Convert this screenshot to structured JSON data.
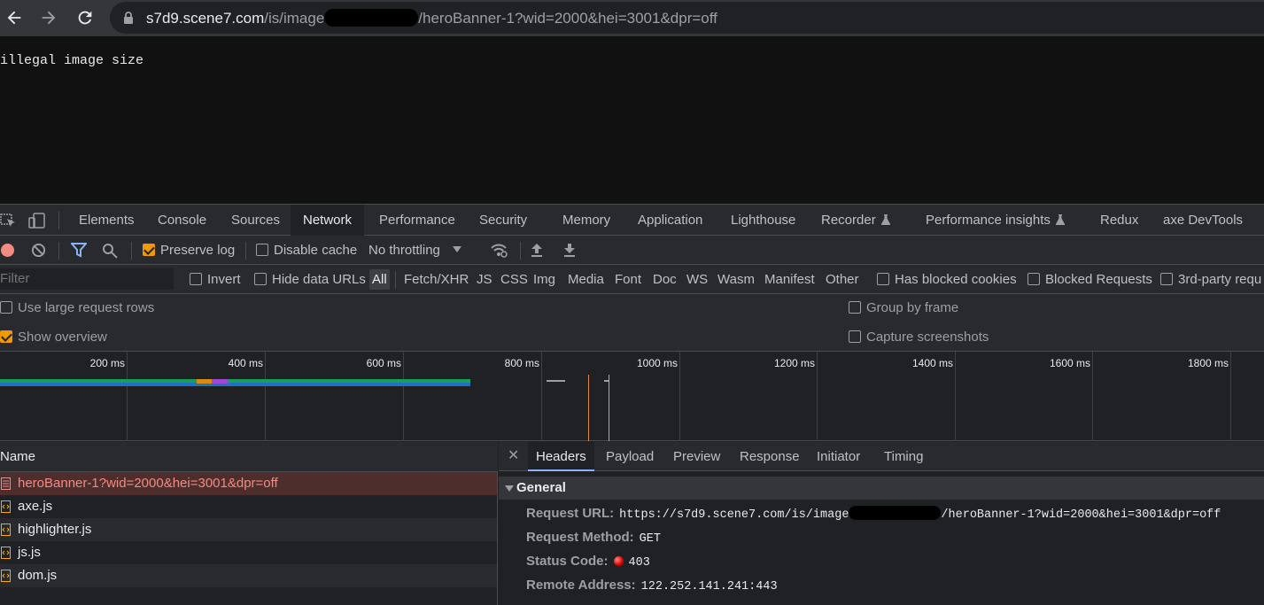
{
  "browser": {
    "url_host": "s7d9.scene7.com",
    "url_path_prefix": "/is/image",
    "url_path_suffix": "/heroBanner-1?wid=2000&hei=3001&dpr=off"
  },
  "page": {
    "body_text": "illegal image size"
  },
  "devtools": {
    "tabs": [
      "Elements",
      "Console",
      "Sources",
      "Network",
      "Performance",
      "Security",
      "Memory",
      "Application",
      "Lighthouse",
      "Recorder",
      "Performance insights",
      "Redux",
      "axe DevTools"
    ],
    "active_tab": "Network",
    "toolbar": {
      "preserve_log": "Preserve log",
      "preserve_log_checked": true,
      "disable_cache": "Disable cache",
      "disable_cache_checked": false,
      "throttling": "No throttling"
    },
    "filter": {
      "placeholder": "Filter",
      "invert": "Invert",
      "hide_data_urls": "Hide data URLs",
      "types": [
        "All",
        "Fetch/XHR",
        "JS",
        "CSS",
        "Img",
        "Media",
        "Font",
        "Doc",
        "WS",
        "Wasm",
        "Manifest",
        "Other"
      ],
      "active_type": "All",
      "has_blocked_cookies": "Has blocked cookies",
      "blocked_requests": "Blocked Requests",
      "third_party": "3rd-party requ"
    },
    "options": {
      "use_large_rows": "Use large request rows",
      "use_large_rows_checked": false,
      "show_overview": "Show overview",
      "show_overview_checked": true,
      "group_by_frame": "Group by frame",
      "group_by_frame_checked": false,
      "capture_screenshots": "Capture screenshots",
      "capture_screenshots_checked": false
    },
    "overview": {
      "tick_labels": [
        "200 ms",
        "400 ms",
        "600 ms",
        "800 ms",
        "1000 ms",
        "1200 ms",
        "1400 ms",
        "1600 ms",
        "1800 ms"
      ]
    },
    "requests": {
      "column_name": "Name",
      "rows": [
        {
          "name": "heroBanner-1?wid=2000&hei=3001&dpr=off",
          "type": "doc",
          "selected": true
        },
        {
          "name": "axe.js",
          "type": "script"
        },
        {
          "name": "highlighter.js",
          "type": "script"
        },
        {
          "name": "js.js",
          "type": "script"
        },
        {
          "name": "dom.js",
          "type": "script"
        }
      ]
    },
    "details": {
      "tabs": [
        "Headers",
        "Payload",
        "Preview",
        "Response",
        "Initiator",
        "Timing"
      ],
      "active_tab": "Headers",
      "section_title": "General",
      "request_url_label": "Request URL:",
      "request_url_prefix": "https://s7d9.scene7.com/is/image",
      "request_url_suffix": "/heroBanner-1?wid=2000&hei=3001&dpr=off",
      "request_method_label": "Request Method:",
      "request_method": "GET",
      "status_code_label": "Status Code:",
      "status_code": "403",
      "remote_address_label": "Remote Address:",
      "remote_address": "122.252.141.241:443"
    }
  },
  "colors": {
    "accent_orange": "#f29900",
    "error_red": "#f28b82",
    "selected_row_bg": "#4e2e2c"
  }
}
